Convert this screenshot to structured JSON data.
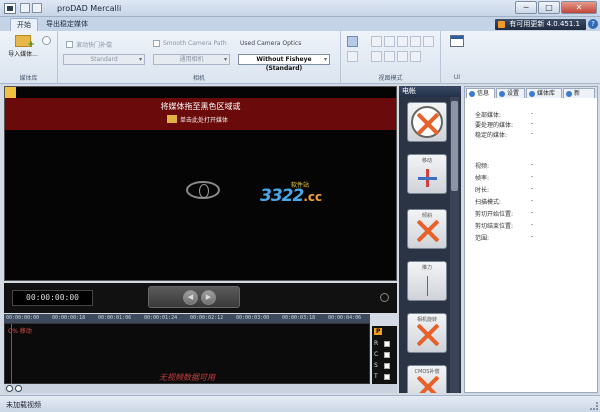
{
  "window": {
    "title": "proDAD Mercalli",
    "minimize": "─",
    "maximize": "□",
    "close": "✕"
  },
  "ribbon": {
    "tabs": [
      "开始",
      "导出稳定媒体"
    ],
    "update": "有可用更新 4.0.451.1",
    "help": "?",
    "groups": {
      "library": {
        "import_label": "导入媒体...",
        "label": "媒体库"
      },
      "camera": {
        "rolling_shutter": "滚动快门补偿",
        "smooth_path": "Smooth Camera Path",
        "optics_title": "Used Camera Optics",
        "standard": "Standard",
        "generic_camera": "通用相机",
        "optics_value": "Without Fisheye (Standard)",
        "label": "相机"
      },
      "view": {
        "label": "视图模式"
      },
      "ui": {
        "label": "UI"
      }
    }
  },
  "media": {
    "drop_title": "将媒体拖至黑色区域或",
    "drop_link": "单击此处打开媒体",
    "watermark_main": "3322",
    "watermark_cc": ".cc",
    "watermark_sub": "软件站"
  },
  "transport": {
    "timecode": "00:00:00:00",
    "prev": "◀",
    "next": "▶"
  },
  "timeline": {
    "ticks": [
      "00:00:00:00",
      "00:00:00:18",
      "00:00:01:06",
      "00:00:01:24",
      "00:00:02:12",
      "00:00:03:00",
      "00:00:03:18",
      "00:00:04:06"
    ],
    "track_label": "C% 移动",
    "no_video": "无视频数据可用",
    "track_buttons": [
      "P",
      "R",
      "C",
      "S",
      "T"
    ]
  },
  "motion_panel": {
    "title": "电帐",
    "tiles": [
      "",
      "移动",
      "倾斜",
      "推力",
      "相机旋转",
      "CMOS补偿"
    ]
  },
  "info_panel": {
    "tabs": [
      "信息",
      "设置",
      "媒体库",
      "新"
    ],
    "rows": [
      {
        "label": "全部媒体:",
        "value": "-"
      },
      {
        "label": "要处理的媒体:",
        "value": "-"
      },
      {
        "label": "稳定的媒体:",
        "value": "-"
      },
      {
        "label": "视频:",
        "value": "-"
      },
      {
        "label": "帧率:",
        "value": "-"
      },
      {
        "label": "时长:",
        "value": "-"
      },
      {
        "label": "扫描模式:",
        "value": "-"
      },
      {
        "label": "剪切开始位置:",
        "value": "-"
      },
      {
        "label": "剪切结束位置:",
        "value": "-"
      },
      {
        "label": "范围:",
        "value": "-"
      }
    ]
  },
  "status": {
    "text": "未加载视频"
  },
  "colors": {
    "drop_zone": "#6b0a0a",
    "accent": "#e8602a",
    "no_video": "#c94040"
  }
}
